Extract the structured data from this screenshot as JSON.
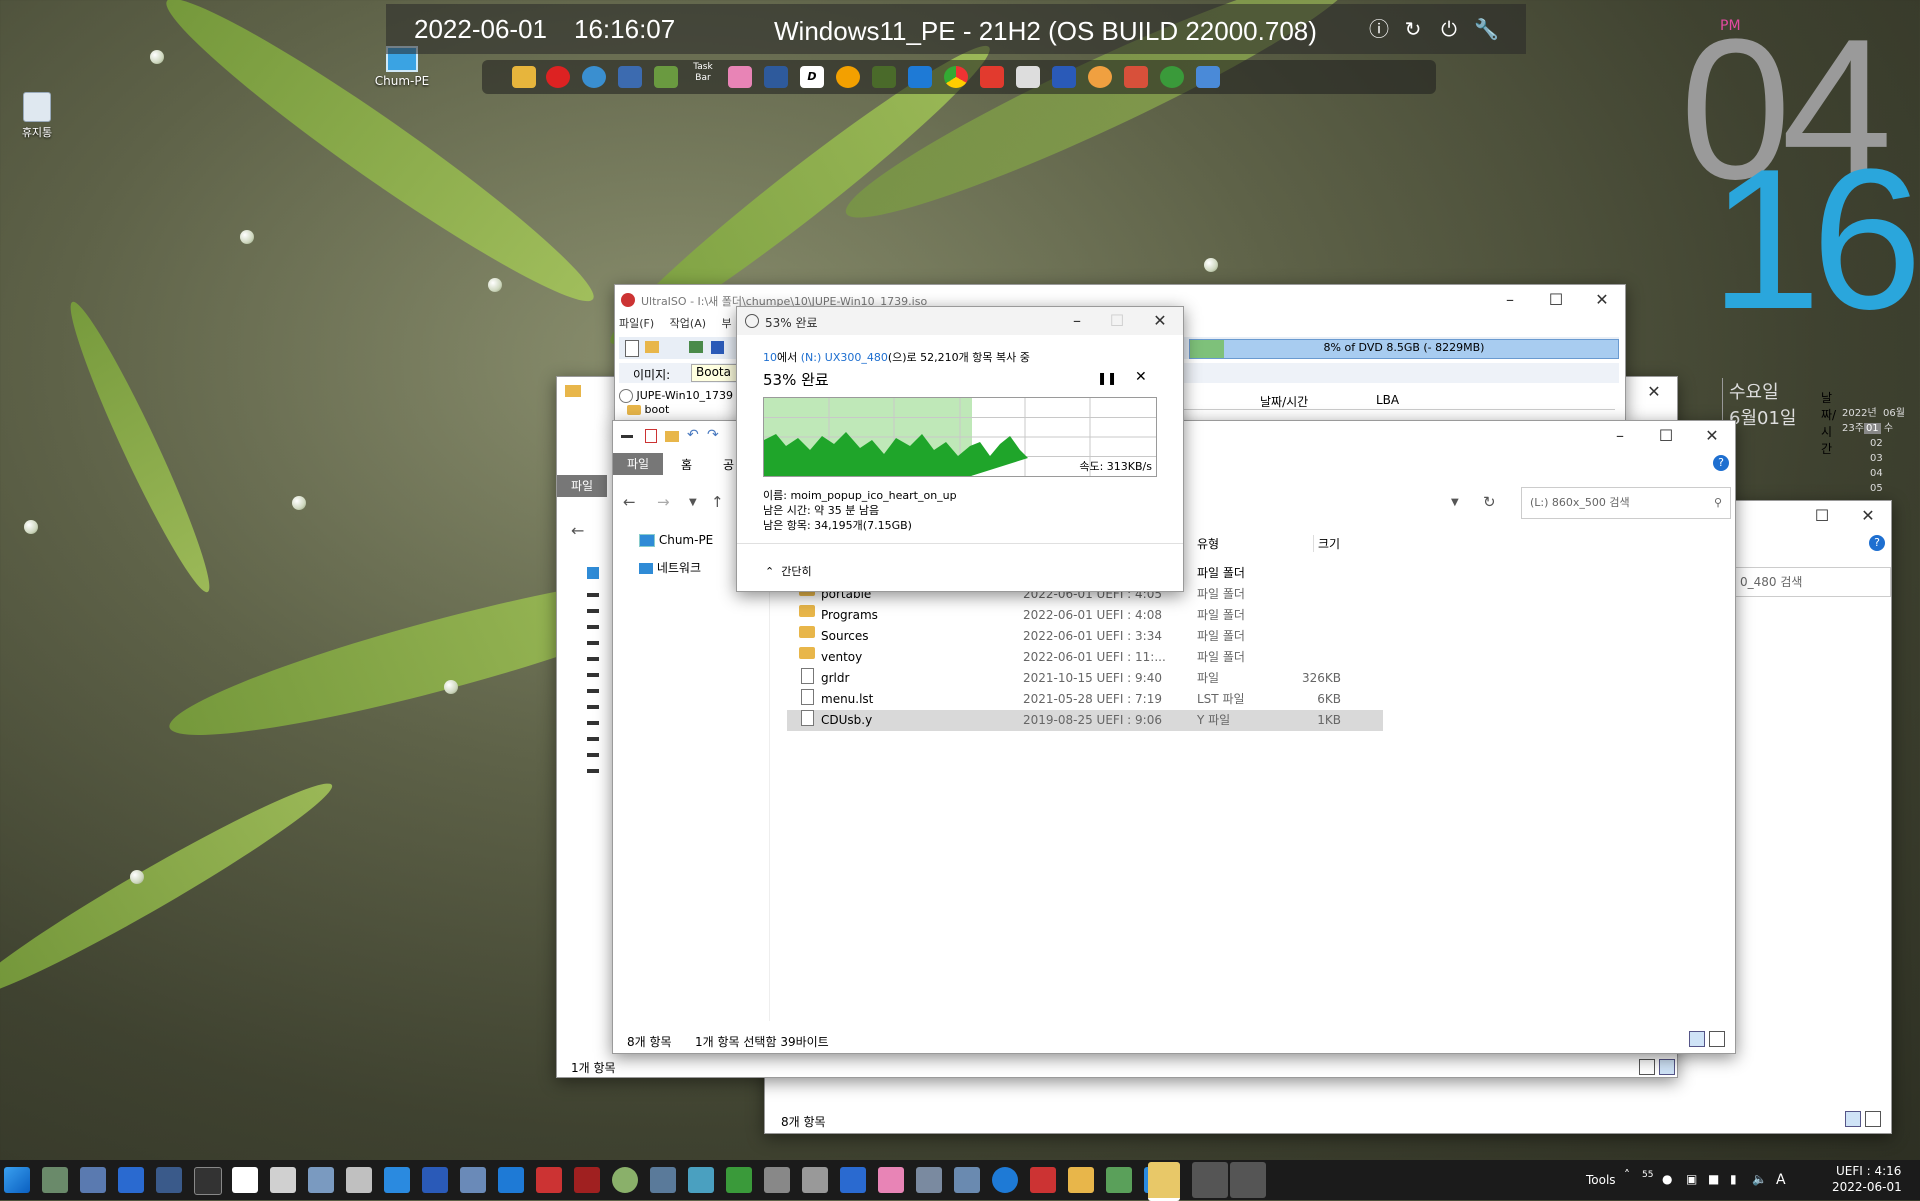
{
  "topbar": {
    "date": "2022-06-01",
    "time": "16:16:07",
    "title": "Windows11_PE - 21H2 (OS BUILD 22000.708)"
  },
  "quickbar": {
    "taskbar_label": "Task\nBar",
    "d_label": "D"
  },
  "desktop": {
    "recycle_bin": "휴지통",
    "chum_pe": "Chum-PE"
  },
  "clock": {
    "ampm": "PM",
    "hour": "04",
    "minute": "16",
    "weekday": "수요일",
    "date": "6월01일",
    "cal_header_year": "2022년",
    "cal_header_month": "06월",
    "cal_week": "23주",
    "cal_days": [
      "01",
      "02",
      "03",
      "04",
      "05"
    ],
    "cal_dow": "수"
  },
  "ultraiso": {
    "title": "UltraISO - I:\\새 폴더\\chumpe\\10\\JUPE-Win10_1739.iso",
    "menu": [
      "파일(F)",
      "작업(A)",
      "부"
    ],
    "capacity": "8% of DVD 8.5GB (- 8229MB)",
    "image_label": "이미지:",
    "image_value": "Boota",
    "tree_root": "JUPE-Win10_1739",
    "tree_child": "boot",
    "col_datetime": "날짜/시간",
    "col_lba": "LBA"
  },
  "copy_dialog": {
    "title": "53% 완료",
    "src_prefix": "10",
    "src_mid": "에서 ",
    "dest": "(N:) UX300_480",
    "src_suffix": "(으)로 52,210개 항목 복사 중",
    "heading": "53% 완료",
    "speed": "속도: 313KB/s",
    "progress_pct": 53,
    "name": "이름: moim_popup_ico_heart_on_up",
    "time_left": "남은 시간: 약 35 분 남음",
    "items_left": "남은 항목: 34,195개(7.15GB)",
    "less": "간단히"
  },
  "explorer_back": {
    "tab_file": "파일",
    "status": "1개 항목"
  },
  "explorer_main": {
    "ribbon_tabs": [
      "파일",
      "홈",
      "공"
    ],
    "nav": [
      "Chum-PE",
      "네트워크"
    ],
    "search_placeholder": "(L:) 860x_500 검색",
    "columns": {
      "type": "유형",
      "size": "크기"
    },
    "rows": [
      {
        "name": "portable",
        "date": "2022-06-01 UEFI : 4:05",
        "type": "파일 폴더",
        "size": "",
        "kind": "folder"
      },
      {
        "name": "Programs",
        "date": "2022-06-01 UEFI : 4:08",
        "type": "파일 폴더",
        "size": "",
        "kind": "folder"
      },
      {
        "name": "Sources",
        "date": "2022-06-01 UEFI : 3:34",
        "type": "파일 폴더",
        "size": "",
        "kind": "folder"
      },
      {
        "name": "ventoy",
        "date": "2022-06-01 UEFI : 11:...",
        "type": "파일 폴더",
        "size": "",
        "kind": "folder"
      },
      {
        "name": "grldr",
        "date": "2021-10-15 UEFI : 9:40",
        "type": "파일",
        "size": "326KB",
        "kind": "file"
      },
      {
        "name": "menu.lst",
        "date": "2021-05-28 UEFI : 7:19",
        "type": "LST 파일",
        "size": "6KB",
        "kind": "file"
      },
      {
        "name": "CDUsb.y",
        "date": "2019-08-25 UEFI : 9:06",
        "type": "Y 파일",
        "size": "1KB",
        "kind": "file"
      }
    ],
    "first_type": "파일 폴더",
    "status_count": "8개 항목",
    "status_selected": "1개 항목 선택함 39바이트"
  },
  "explorer_right": {
    "search_placeholder": "0_480 검색",
    "status": "8개 항목"
  },
  "taskbar": {
    "tools": "Tools",
    "tray_num": "55",
    "ime": "A",
    "clock_time": "UEFI : 4:16",
    "clock_date": "2022-06-01"
  }
}
